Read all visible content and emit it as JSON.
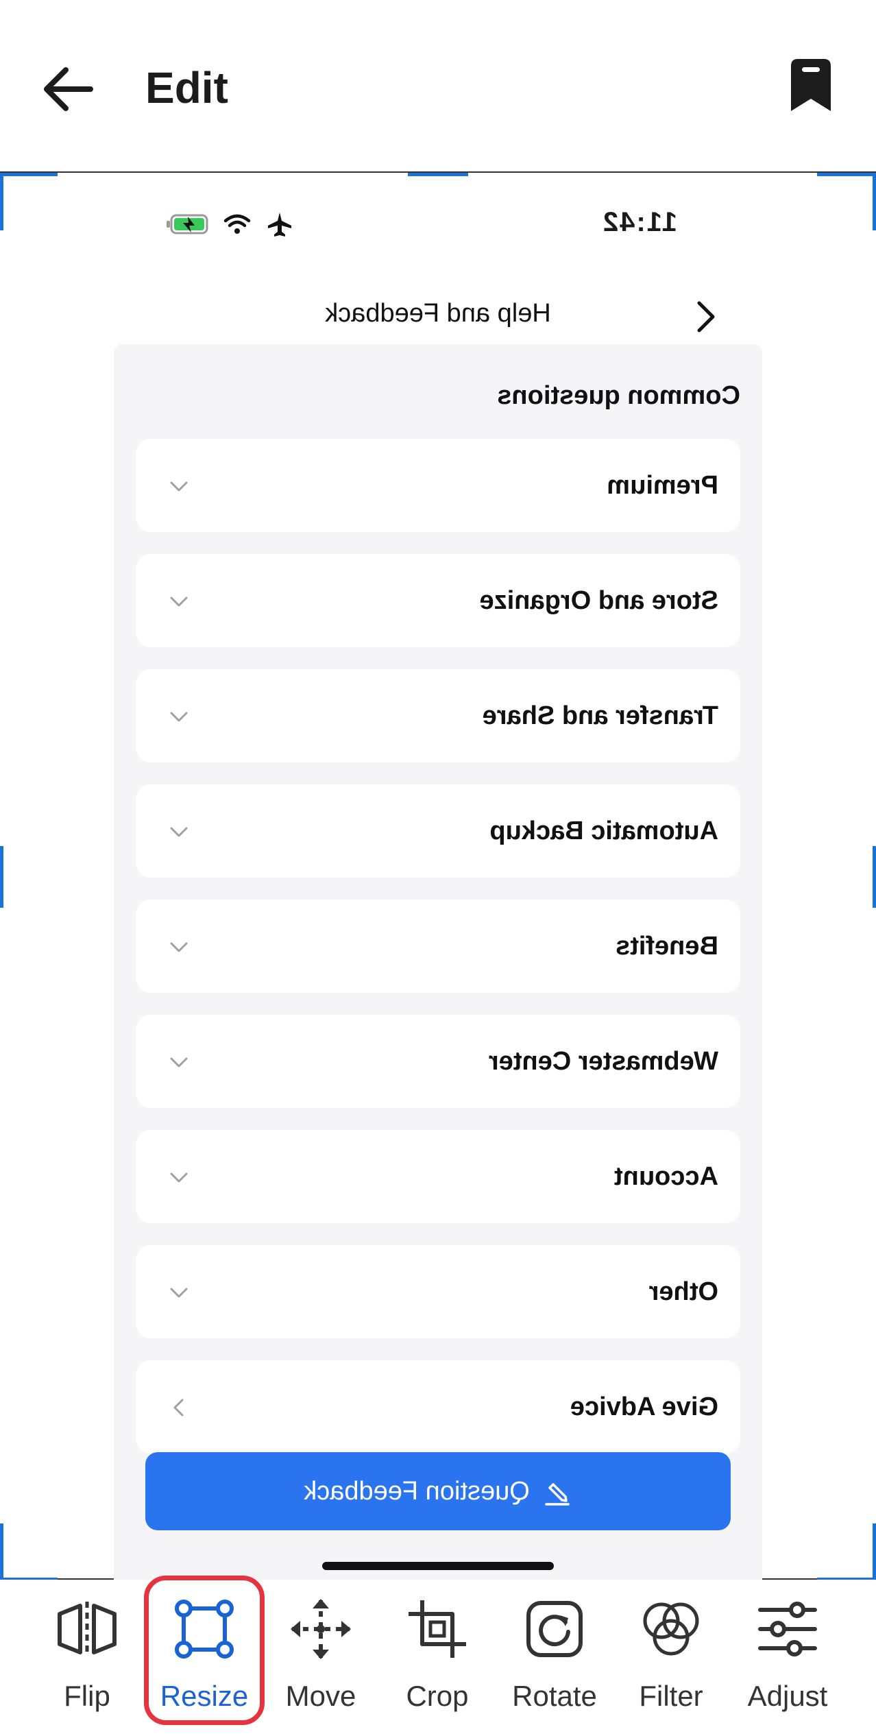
{
  "header": {
    "title": "Edit",
    "back_icon": "arrow-left-icon",
    "bookmark_icon": "bookmark-icon"
  },
  "preview": {
    "status_bar": {
      "time": "11:42",
      "icons": [
        "battery-charging-icon",
        "wifi-icon",
        "airplane-icon"
      ]
    },
    "nav": {
      "title": "Help and Feedback",
      "back_icon": "chevron-left-icon"
    },
    "section_title": "Common questions",
    "items": [
      {
        "label": "Premium",
        "icon": "chevron-down-icon"
      },
      {
        "label": "Store and Organize",
        "icon": "chevron-down-icon"
      },
      {
        "label": "Transfer and Share",
        "icon": "chevron-down-icon"
      },
      {
        "label": "Automatic Backup",
        "icon": "chevron-down-icon"
      },
      {
        "label": "Benefits",
        "icon": "chevron-down-icon"
      },
      {
        "label": "Webmaster Center",
        "icon": "chevron-down-icon"
      },
      {
        "label": "Account",
        "icon": "chevron-down-icon"
      },
      {
        "label": "Other",
        "icon": "chevron-down-icon"
      },
      {
        "label": "Give Advice",
        "icon": "chevron-right-icon"
      }
    ],
    "button_label": "Question Feedback",
    "button_icon": "edit-pencil-icon",
    "button_color": "#2a74f0"
  },
  "toolbar": {
    "tools": [
      {
        "label": "Flip",
        "icon": "flip-icon"
      },
      {
        "label": "Resize",
        "icon": "resize-icon",
        "active": true
      },
      {
        "label": "Move",
        "icon": "move-icon"
      },
      {
        "label": "Crop",
        "icon": "crop-icon"
      },
      {
        "label": "Rotate",
        "icon": "rotate-icon"
      },
      {
        "label": "Filter",
        "icon": "filter-icon"
      },
      {
        "label": "Adjust",
        "icon": "adjust-icon"
      }
    ],
    "active_color": "#1a63d6",
    "highlight_color": "#e5343f"
  },
  "selection_handle_color": "#1a73d9"
}
